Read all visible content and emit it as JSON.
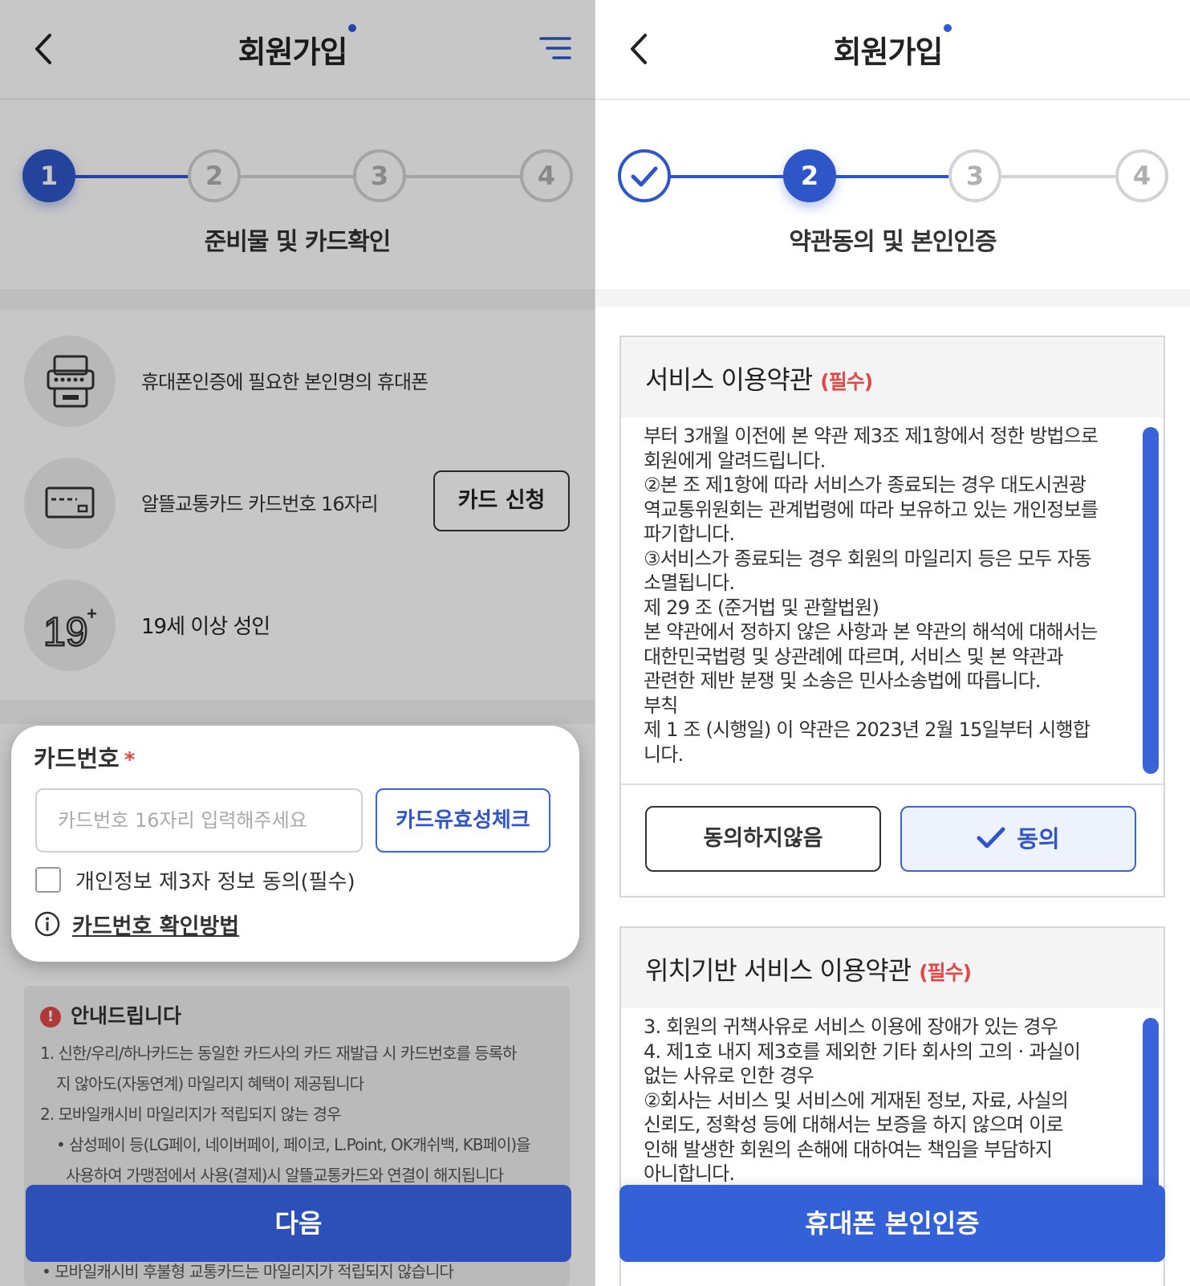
{
  "left": {
    "header": {
      "title": "회원가입"
    },
    "steps": [
      "1",
      "2",
      "3",
      "4"
    ],
    "step_label": "준비물 및 카드확인",
    "requirements": [
      {
        "icon": "phone-icon",
        "text": "휴대폰인증에 필요한 본인명의 휴대폰"
      },
      {
        "icon": "card-icon",
        "text": "알뜰교통카드 카드번호 16자리",
        "button": "카드 신청"
      },
      {
        "icon": "age-19-icon",
        "text": "19세 이상 성인"
      }
    ],
    "card_form": {
      "label": "카드번호",
      "required_mark": "*",
      "input_placeholder": "카드번호 16자리 입력해주세요",
      "check_button": "카드유효성체크",
      "consent_label": "개인정보 제3자 정보 동의(필수)",
      "help_link": "카드번호 확인방법"
    },
    "notice": {
      "heading": "안내드립니다",
      "lines": [
        "1. 신한/우리/하나카드는 동일한 카드사의 카드 재발급 시 카드번호를 등록하",
        "지 않아도(자동연계) 마일리지 혜택이 제공됩니다",
        "2.  모바일캐시비 마일리지가 적립되지 않는 경우",
        "• 삼성페이 등(LG페이, 네이버페이, 페이코, L.Point, OK캐쉬백, KB페이)을",
        "사용하여 가맹점에서 사용(결제)시 알뜰교통카드와 연결이 해지됩니다"
      ],
      "hidden_line": "• 모바일캐시비 후불형 교통카드는 마일리지가 적립되지 않습니다"
    },
    "next_button": "다음"
  },
  "right": {
    "header": {
      "title": "회원가입"
    },
    "steps": [
      "✓",
      "2",
      "3",
      "4"
    ],
    "step_label": "약관동의 및 본인인증",
    "terms1": {
      "title": "서비스 이용약관",
      "required": "(필수)",
      "lines": [
        "부터 3개월 이전에 본 약관 제3조 제1항에서 정한 방법으로",
        "회원에게 알려드립니다.",
        "②본 조 제1항에 따라 서비스가 종료되는 경우 대도시권광",
        "역교통위원회는 관계법령에 따라 보유하고 있는 개인정보를",
        "파기합니다.",
        "③서비스가 종료되는 경우 회원의 마일리지 등은 모두 자동",
        "소멸됩니다.",
        "제 29 조 (준거법 및 관할법원)",
        "본 약관에서 정하지 않은 사항과 본 약관의 해석에 대해서는",
        " 대한민국법령 및 상관례에 따르며, 서비스 및 본 약관과",
        "관련한 제반 분쟁 및 소송은 민사소송법에 따릅니다.",
        "부칙",
        "제 1 조 (시행일) 이 약관은 2023년 2월 15일부터 시행합",
        "니다."
      ],
      "disagree": "동의하지않음",
      "agree": "동의"
    },
    "terms2": {
      "title": "위치기반 서비스 이용약관",
      "required": "(필수)",
      "lines": [
        "3. 회원의 귀책사유로 서비스 이용에 장애가 있는 경우",
        "4. 제1호 내지 제3호를 제외한 기타 회사의 고의 · 과실이",
        "없는 사유로 인한 경우",
        "②회사는 서비스 및 서비스에 게재된 정보, 자료, 사실의",
        "신뢰도, 정확성 등에 대해서는 보증을 하지 않으며 이로",
        "인해 발생한 회원의 손해에 대하여는 책임을 부담하지",
        "아니합니다."
      ]
    },
    "verify_button": "휴대폰 본인인증"
  },
  "colors": {
    "primary": "#2e56c9",
    "required": "#e04848",
    "overlay": "rgba(0,0,0,0.22)"
  }
}
